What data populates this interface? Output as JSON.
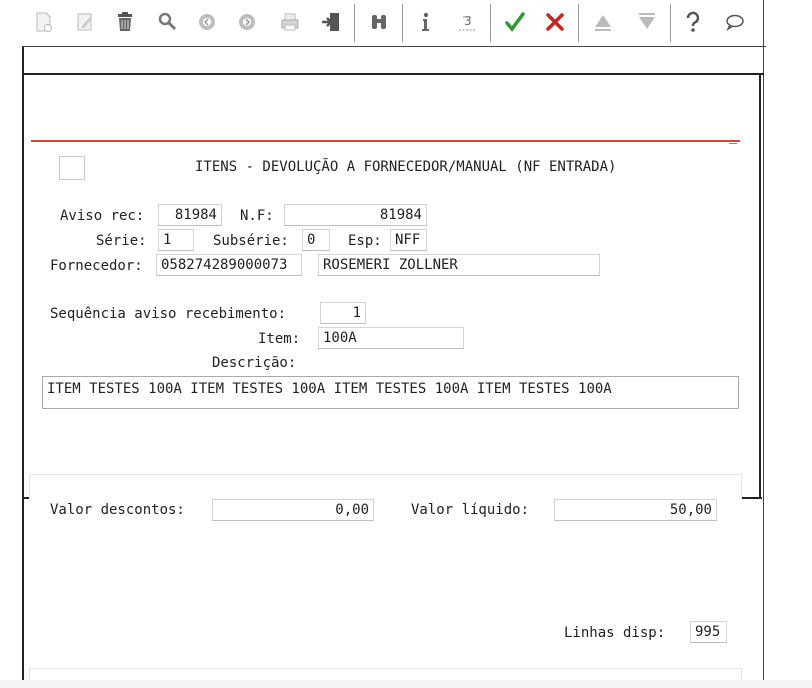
{
  "toolbar": {
    "icons": [
      "new-doc-icon",
      "edit-icon",
      "trash-icon",
      "search-icon",
      "circle-left-icon",
      "circle-right-icon",
      "print-icon",
      "exit-icon",
      "binoculars-icon",
      "info-icon",
      "sum-icon",
      "check-icon",
      "cancel-icon",
      "triangle-up-icon",
      "triangle-down-icon",
      "help-icon",
      "comment-icon"
    ]
  },
  "form": {
    "title": "ITENS - DEVOLUÇÃO A FORNECEDOR/MANUAL (NF ENTRADA)",
    "aviso_rec_label": "Aviso rec:",
    "aviso_rec_value": "81984",
    "nf_label": "N.F:",
    "nf_value": "81984",
    "serie_label": "Série:",
    "serie_value": "1",
    "subserie_label": "Subsérie:",
    "subserie_value": "0",
    "esp_label": "Esp:",
    "esp_value": "NFF",
    "fornecedor_label": "Fornecedor:",
    "fornecedor_code": "058274289000073",
    "fornecedor_name": "ROSEMERI ZOLLNER",
    "sequencia_label": "Sequência aviso recebimento:",
    "sequencia_value": "1",
    "item_label": "Item:",
    "item_value": "100A",
    "descricao_label": "Descrição:",
    "descricao_value": "ITEM TESTES 100A ITEM TESTES 100A ITEM TESTES 100A ITEM TESTES 100A"
  },
  "totals": {
    "valor_descontos_label": "Valor descontos:",
    "valor_descontos_value": "0,00",
    "valor_liquido_label": "Valor líquido:",
    "valor_liquido_value": "50,00",
    "linhas_disp_label": "Linhas disp:",
    "linhas_disp_value": "995"
  },
  "colors": {
    "accent_line": "#e03c3c",
    "check": "#2e9a2e",
    "cancel": "#cc2222"
  }
}
